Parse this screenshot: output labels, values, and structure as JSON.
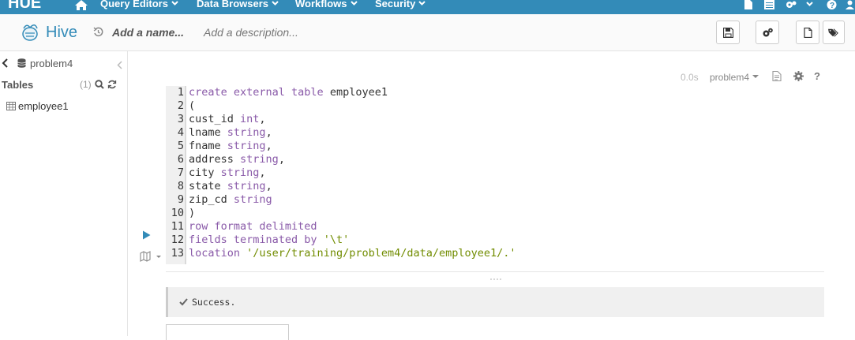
{
  "nav": {
    "logo": "HUE",
    "menus": [
      {
        "label": "Query Editors"
      },
      {
        "label": "Data Browsers"
      },
      {
        "label": "Workflows"
      },
      {
        "label": "Security"
      }
    ]
  },
  "appbar": {
    "title": "Hive",
    "name_placeholder": "Add a name...",
    "description_placeholder": "Add a description..."
  },
  "sidebar": {
    "database": "problem4",
    "tables_label": "Tables",
    "tables_count": "(1)",
    "tables": [
      {
        "name": "employee1"
      }
    ]
  },
  "snippet": {
    "execution_time": "0.0s",
    "database": "problem4"
  },
  "editor": {
    "lines": [
      {
        "n": "1"
      },
      {
        "n": "2"
      },
      {
        "n": "3"
      },
      {
        "n": "4"
      },
      {
        "n": "5"
      },
      {
        "n": "6"
      },
      {
        "n": "7"
      },
      {
        "n": "8"
      },
      {
        "n": "9"
      },
      {
        "n": "10"
      },
      {
        "n": "11"
      },
      {
        "n": "12"
      },
      {
        "n": "13"
      }
    ],
    "tokens": {
      "l1_kw": "create external table",
      "l1_id": " employee1",
      "l2": "(",
      "l3_id": "cust_id ",
      "l3_kw": "int",
      "l3_p": ",",
      "l4_id": "lname ",
      "l4_kw": "string",
      "l4_p": ",",
      "l5_id": "fname ",
      "l5_kw": "string",
      "l5_p": ",",
      "l6_id": "address ",
      "l6_kw": "string",
      "l6_p": ",",
      "l7_id": "city ",
      "l7_kw": "string",
      "l7_p": ",",
      "l8_id": "state ",
      "l8_kw": "string",
      "l8_p": ",",
      "l9_id": "zip_cd ",
      "l9_kw": "string",
      "l10": ")",
      "l11_kw": "row format delimited",
      "l12_kw": "fields terminated by ",
      "l12_str": "'\\t'",
      "l13_kw": "location ",
      "l13_str": "'/user/training/problem4/data/employee1/.'"
    }
  },
  "result": {
    "status": "Success."
  },
  "colors": {
    "nav_bg": "#338bb8",
    "keyword": "#8959a8",
    "string": "#718c00"
  }
}
